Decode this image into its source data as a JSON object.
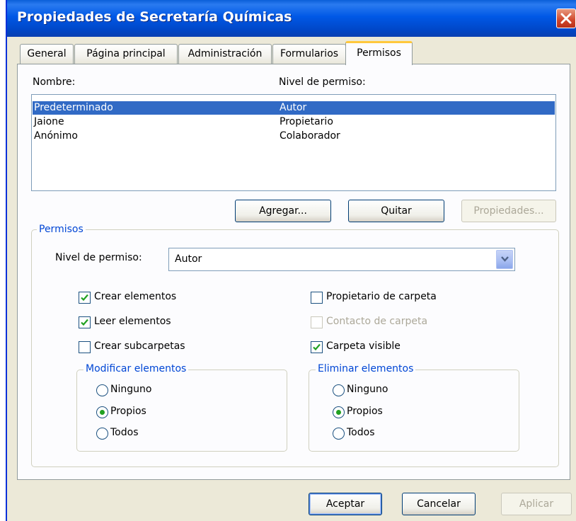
{
  "window": {
    "title": "Propiedades de Secretaría Químicas",
    "close_label": "×"
  },
  "tabs": [
    {
      "label": "General",
      "active": false
    },
    {
      "label": "Página principal",
      "active": false
    },
    {
      "label": "Administración",
      "active": false
    },
    {
      "label": "Formularios",
      "active": false
    },
    {
      "label": "Permisos",
      "active": true
    }
  ],
  "list": {
    "header_name": "Nombre:",
    "header_level": "Nivel de permiso:",
    "rows": [
      {
        "name": "Predeterminado",
        "level": "Autor",
        "selected": true
      },
      {
        "name": "Jaione",
        "level": "Propietario",
        "selected": false
      },
      {
        "name": "Anónimo",
        "level": "Colaborador",
        "selected": false
      }
    ]
  },
  "list_buttons": {
    "add": "Agregar...",
    "remove": "Quitar",
    "properties": "Propiedades..."
  },
  "permissions": {
    "group_title": "Permisos",
    "level_label": "Nivel de permiso:",
    "level_value": "Autor",
    "checkboxes": {
      "create_items": {
        "label": "Crear elementos",
        "checked": true,
        "enabled": true
      },
      "read_items": {
        "label": "Leer elementos",
        "checked": true,
        "enabled": true
      },
      "create_subfolders": {
        "label": "Crear subcarpetas",
        "checked": false,
        "enabled": true
      },
      "folder_owner": {
        "label": "Propietario de carpeta",
        "checked": false,
        "enabled": true
      },
      "folder_contact": {
        "label": "Contacto de carpeta",
        "checked": false,
        "enabled": false
      },
      "folder_visible": {
        "label": "Carpeta visible",
        "checked": true,
        "enabled": true
      }
    },
    "edit_items": {
      "title": "Modificar elementos",
      "options": [
        "Ninguno",
        "Propios",
        "Todos"
      ],
      "selected": "Propios"
    },
    "delete_items": {
      "title": "Eliminar elementos",
      "options": [
        "Ninguno",
        "Propios",
        "Todos"
      ],
      "selected": "Propios"
    }
  },
  "footer": {
    "ok": "Aceptar",
    "cancel": "Cancelar",
    "apply": "Aplicar"
  },
  "colors": {
    "title_bar": "#0054e3",
    "selection": "#316ac5",
    "group_title": "#0046d5",
    "check_mark": "#21a121",
    "active_tab_highlight": "#ffc83c"
  }
}
